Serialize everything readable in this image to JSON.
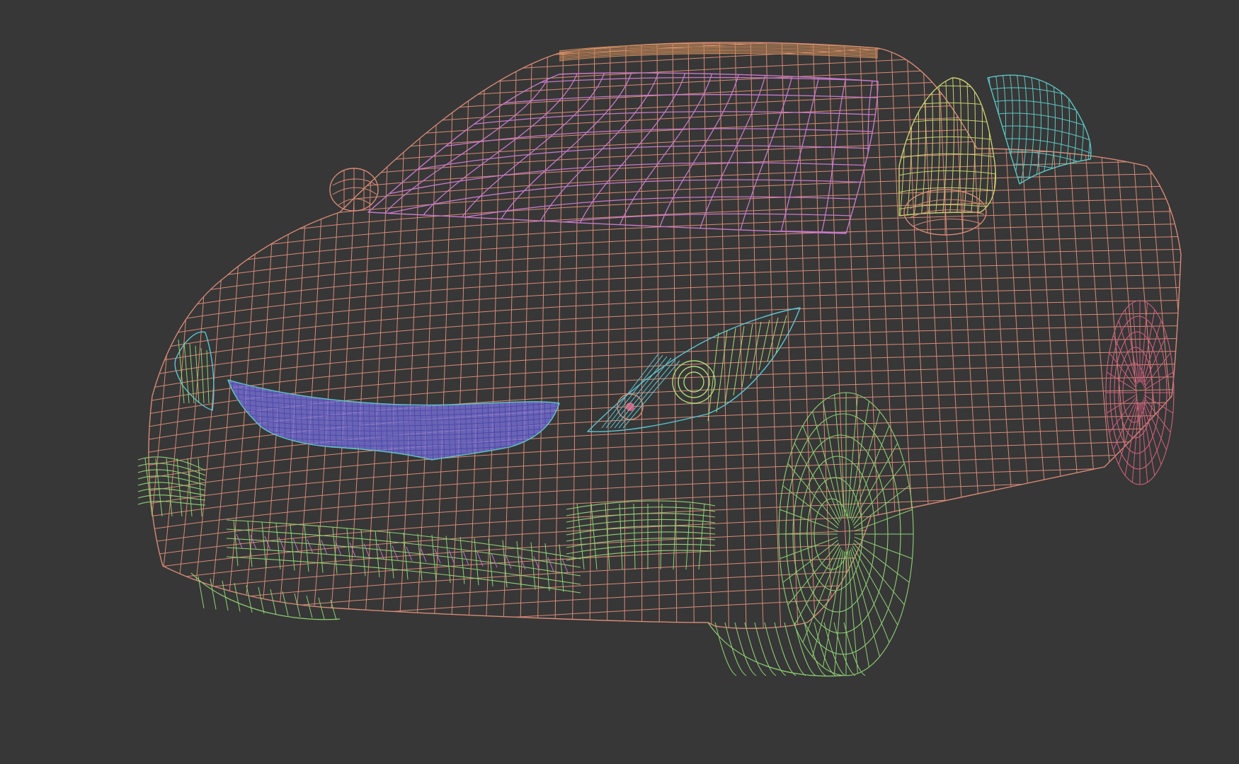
{
  "scene": {
    "subject": "car-wireframe",
    "view": "front-three-quarter",
    "colors": {
      "background": "#373737",
      "body": "#d88a76",
      "windshield": "#c77ac9",
      "roof_strip": "#c98a5a",
      "grille": "#7b74e0",
      "grille_outline": "#5fc7c4",
      "wheels": "#8fd074",
      "rear_wheel": "#d0607f",
      "window_front": "#c9d070",
      "window_rear": "#5cc7c4",
      "fog_lamps": "#8fd074",
      "headlight_blue": "#5cc7d4",
      "headlight_green": "#a9d878",
      "indicator": "#e05a7a"
    },
    "parts": [
      "body-shell",
      "windshield",
      "roof-strip",
      "front-grille",
      "left-headlight",
      "right-headlight",
      "left-fog-lamp",
      "right-fog-lamp",
      "lower-grille",
      "front-wheel",
      "rear-wheel",
      "side-mirror-left",
      "side-mirror-right",
      "front-side-window",
      "rear-side-window"
    ]
  }
}
